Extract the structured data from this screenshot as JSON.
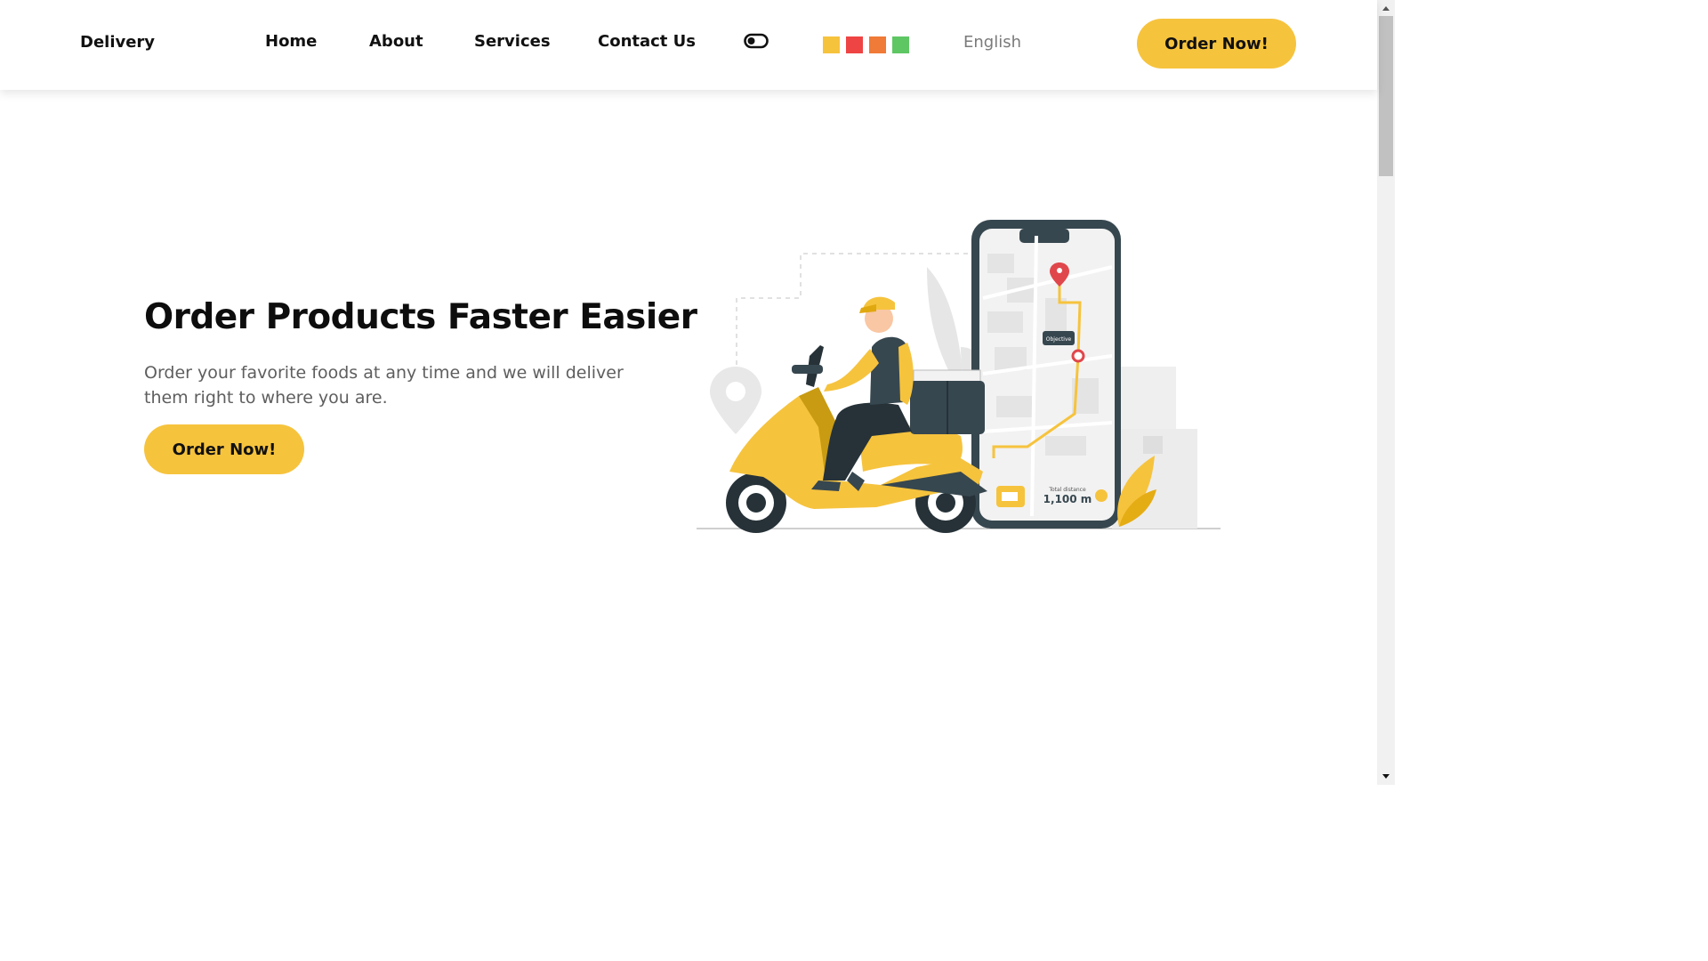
{
  "header": {
    "brand": "Delivery",
    "nav": [
      "Home",
      "About",
      "Services",
      "Contact Us"
    ],
    "theme_toggle_icon": "toggle-icon",
    "swatches": [
      "#f6c33d",
      "#ef4444",
      "#f07a37",
      "#5ec763"
    ],
    "language": "English",
    "cta_label": "Order Now!"
  },
  "hero": {
    "title": "Order Products Faster Easier",
    "subtitle": "Order your favorite foods at any time and we will deliver them right to where you are.",
    "cta_label": "Order Now!",
    "phone_card_value": "1,100 m",
    "phone_card_caption": "Total distance",
    "map_marker_label": "Objective"
  },
  "colors": {
    "accent": "#f6c33d",
    "heading": "#0d0d0d",
    "muted": "#5e5e5e"
  }
}
